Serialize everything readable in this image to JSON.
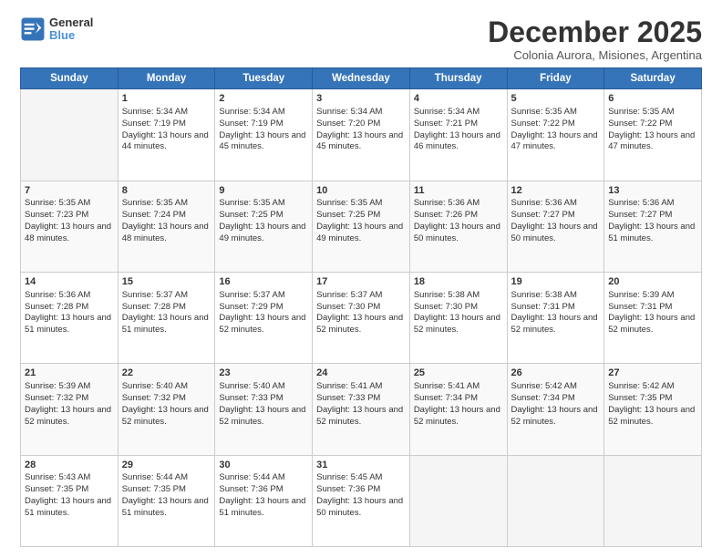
{
  "header": {
    "logo_general": "General",
    "logo_blue": "Blue",
    "month": "December 2025",
    "location": "Colonia Aurora, Misiones, Argentina"
  },
  "days_of_week": [
    "Sunday",
    "Monday",
    "Tuesday",
    "Wednesday",
    "Thursday",
    "Friday",
    "Saturday"
  ],
  "weeks": [
    [
      {
        "day": "",
        "sunrise": "",
        "sunset": "",
        "daylight": "",
        "empty": true
      },
      {
        "day": "1",
        "sunrise": "Sunrise: 5:34 AM",
        "sunset": "Sunset: 7:19 PM",
        "daylight": "Daylight: 13 hours and 44 minutes."
      },
      {
        "day": "2",
        "sunrise": "Sunrise: 5:34 AM",
        "sunset": "Sunset: 7:19 PM",
        "daylight": "Daylight: 13 hours and 45 minutes."
      },
      {
        "day": "3",
        "sunrise": "Sunrise: 5:34 AM",
        "sunset": "Sunset: 7:20 PM",
        "daylight": "Daylight: 13 hours and 45 minutes."
      },
      {
        "day": "4",
        "sunrise": "Sunrise: 5:34 AM",
        "sunset": "Sunset: 7:21 PM",
        "daylight": "Daylight: 13 hours and 46 minutes."
      },
      {
        "day": "5",
        "sunrise": "Sunrise: 5:35 AM",
        "sunset": "Sunset: 7:22 PM",
        "daylight": "Daylight: 13 hours and 47 minutes."
      },
      {
        "day": "6",
        "sunrise": "Sunrise: 5:35 AM",
        "sunset": "Sunset: 7:22 PM",
        "daylight": "Daylight: 13 hours and 47 minutes."
      }
    ],
    [
      {
        "day": "7",
        "sunrise": "Sunrise: 5:35 AM",
        "sunset": "Sunset: 7:23 PM",
        "daylight": "Daylight: 13 hours and 48 minutes."
      },
      {
        "day": "8",
        "sunrise": "Sunrise: 5:35 AM",
        "sunset": "Sunset: 7:24 PM",
        "daylight": "Daylight: 13 hours and 48 minutes."
      },
      {
        "day": "9",
        "sunrise": "Sunrise: 5:35 AM",
        "sunset": "Sunset: 7:25 PM",
        "daylight": "Daylight: 13 hours and 49 minutes."
      },
      {
        "day": "10",
        "sunrise": "Sunrise: 5:35 AM",
        "sunset": "Sunset: 7:25 PM",
        "daylight": "Daylight: 13 hours and 49 minutes."
      },
      {
        "day": "11",
        "sunrise": "Sunrise: 5:36 AM",
        "sunset": "Sunset: 7:26 PM",
        "daylight": "Daylight: 13 hours and 50 minutes."
      },
      {
        "day": "12",
        "sunrise": "Sunrise: 5:36 AM",
        "sunset": "Sunset: 7:27 PM",
        "daylight": "Daylight: 13 hours and 50 minutes."
      },
      {
        "day": "13",
        "sunrise": "Sunrise: 5:36 AM",
        "sunset": "Sunset: 7:27 PM",
        "daylight": "Daylight: 13 hours and 51 minutes."
      }
    ],
    [
      {
        "day": "14",
        "sunrise": "Sunrise: 5:36 AM",
        "sunset": "Sunset: 7:28 PM",
        "daylight": "Daylight: 13 hours and 51 minutes."
      },
      {
        "day": "15",
        "sunrise": "Sunrise: 5:37 AM",
        "sunset": "Sunset: 7:28 PM",
        "daylight": "Daylight: 13 hours and 51 minutes."
      },
      {
        "day": "16",
        "sunrise": "Sunrise: 5:37 AM",
        "sunset": "Sunset: 7:29 PM",
        "daylight": "Daylight: 13 hours and 52 minutes."
      },
      {
        "day": "17",
        "sunrise": "Sunrise: 5:37 AM",
        "sunset": "Sunset: 7:30 PM",
        "daylight": "Daylight: 13 hours and 52 minutes."
      },
      {
        "day": "18",
        "sunrise": "Sunrise: 5:38 AM",
        "sunset": "Sunset: 7:30 PM",
        "daylight": "Daylight: 13 hours and 52 minutes."
      },
      {
        "day": "19",
        "sunrise": "Sunrise: 5:38 AM",
        "sunset": "Sunset: 7:31 PM",
        "daylight": "Daylight: 13 hours and 52 minutes."
      },
      {
        "day": "20",
        "sunrise": "Sunrise: 5:39 AM",
        "sunset": "Sunset: 7:31 PM",
        "daylight": "Daylight: 13 hours and 52 minutes."
      }
    ],
    [
      {
        "day": "21",
        "sunrise": "Sunrise: 5:39 AM",
        "sunset": "Sunset: 7:32 PM",
        "daylight": "Daylight: 13 hours and 52 minutes."
      },
      {
        "day": "22",
        "sunrise": "Sunrise: 5:40 AM",
        "sunset": "Sunset: 7:32 PM",
        "daylight": "Daylight: 13 hours and 52 minutes."
      },
      {
        "day": "23",
        "sunrise": "Sunrise: 5:40 AM",
        "sunset": "Sunset: 7:33 PM",
        "daylight": "Daylight: 13 hours and 52 minutes."
      },
      {
        "day": "24",
        "sunrise": "Sunrise: 5:41 AM",
        "sunset": "Sunset: 7:33 PM",
        "daylight": "Daylight: 13 hours and 52 minutes."
      },
      {
        "day": "25",
        "sunrise": "Sunrise: 5:41 AM",
        "sunset": "Sunset: 7:34 PM",
        "daylight": "Daylight: 13 hours and 52 minutes."
      },
      {
        "day": "26",
        "sunrise": "Sunrise: 5:42 AM",
        "sunset": "Sunset: 7:34 PM",
        "daylight": "Daylight: 13 hours and 52 minutes."
      },
      {
        "day": "27",
        "sunrise": "Sunrise: 5:42 AM",
        "sunset": "Sunset: 7:35 PM",
        "daylight": "Daylight: 13 hours and 52 minutes."
      }
    ],
    [
      {
        "day": "28",
        "sunrise": "Sunrise: 5:43 AM",
        "sunset": "Sunset: 7:35 PM",
        "daylight": "Daylight: 13 hours and 51 minutes."
      },
      {
        "day": "29",
        "sunrise": "Sunrise: 5:44 AM",
        "sunset": "Sunset: 7:35 PM",
        "daylight": "Daylight: 13 hours and 51 minutes."
      },
      {
        "day": "30",
        "sunrise": "Sunrise: 5:44 AM",
        "sunset": "Sunset: 7:36 PM",
        "daylight": "Daylight: 13 hours and 51 minutes."
      },
      {
        "day": "31",
        "sunrise": "Sunrise: 5:45 AM",
        "sunset": "Sunset: 7:36 PM",
        "daylight": "Daylight: 13 hours and 50 minutes."
      },
      {
        "day": "",
        "sunrise": "",
        "sunset": "",
        "daylight": "",
        "empty": true
      },
      {
        "day": "",
        "sunrise": "",
        "sunset": "",
        "daylight": "",
        "empty": true
      },
      {
        "day": "",
        "sunrise": "",
        "sunset": "",
        "daylight": "",
        "empty": true
      }
    ]
  ]
}
